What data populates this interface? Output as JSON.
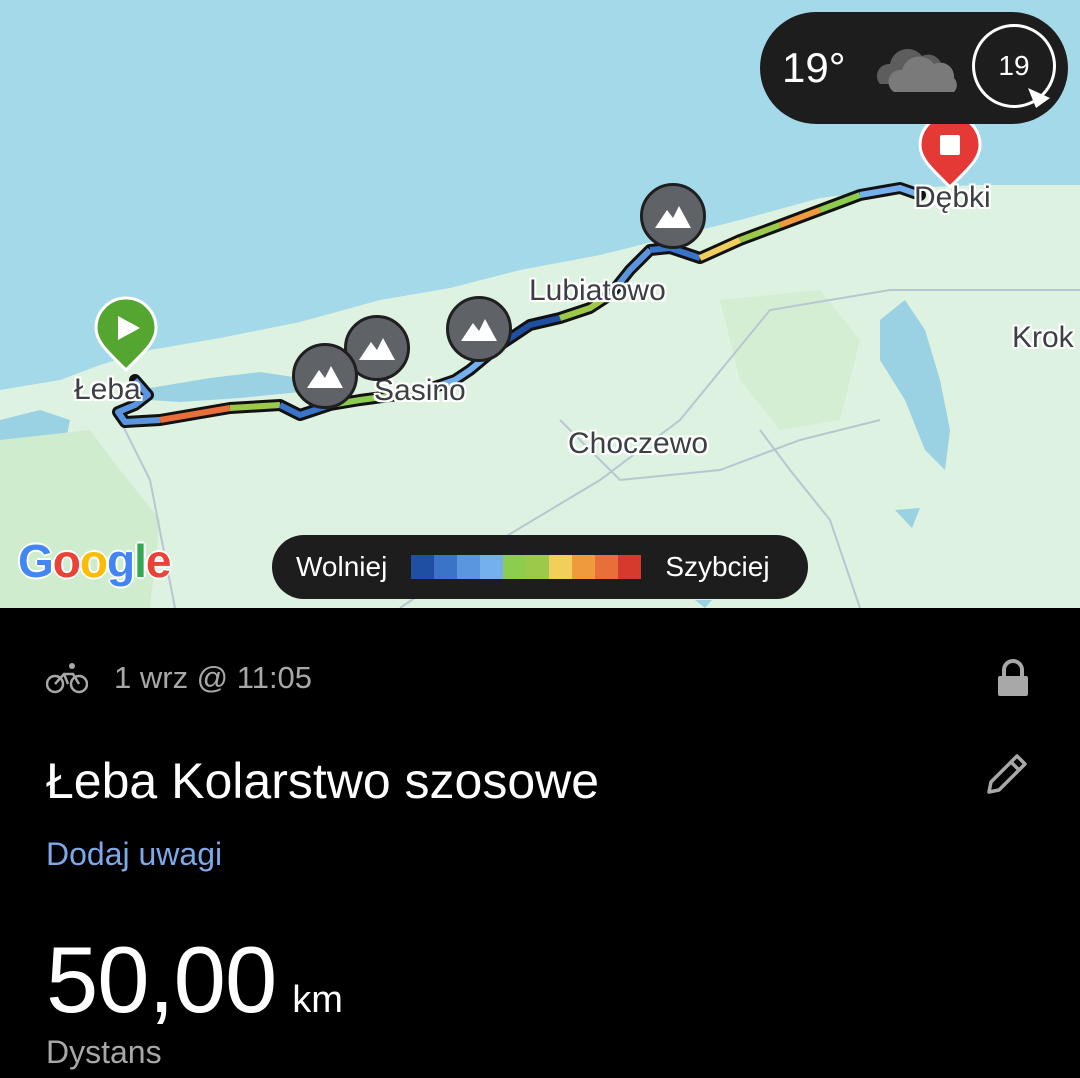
{
  "map": {
    "places": {
      "leba": "Łeba",
      "sasino": "Sasino",
      "lubiatowo": "Lubiatowo",
      "choczewo": "Choczewo",
      "debki": "Dębki",
      "krok": "Krok"
    },
    "google_logo": [
      "G",
      "o",
      "o",
      "g",
      "l",
      "e"
    ],
    "google_colors": [
      "#4285f4",
      "#ea4335",
      "#fbbc05",
      "#4285f4",
      "#34a853",
      "#ea4335"
    ],
    "start_marker_icon": "play-icon",
    "end_marker_icon": "stop-icon",
    "peak_icon": "mountain-icon",
    "colors": {
      "sea": "#a3d9e8",
      "land": "#ddf2e0",
      "lake": "#9ad1e3",
      "start": "#55a630",
      "end": "#e53935"
    }
  },
  "weather": {
    "temperature": "19°",
    "icon": "cloud-icon",
    "gauge_value": "19"
  },
  "legend": {
    "slower": "Wolniej",
    "faster": "Szybciej",
    "gradient": [
      "#1f4fa3",
      "#3a74c9",
      "#5a95e0",
      "#74b0ee",
      "#8ccc4f",
      "#9cc94a",
      "#f2cf5b",
      "#ee9a3d",
      "#e86f3a",
      "#d63a2c"
    ]
  },
  "activity": {
    "sport_icon": "bicycle-icon",
    "date": "1 wrz @ 11:05",
    "lock_icon": "lock-icon",
    "title": "Łeba Kolarstwo szosowe",
    "edit_icon": "pencil-icon",
    "add_notes": "Dodaj uwagi",
    "distance_value": "50,00",
    "distance_unit": "km",
    "distance_label": "Dystans"
  }
}
